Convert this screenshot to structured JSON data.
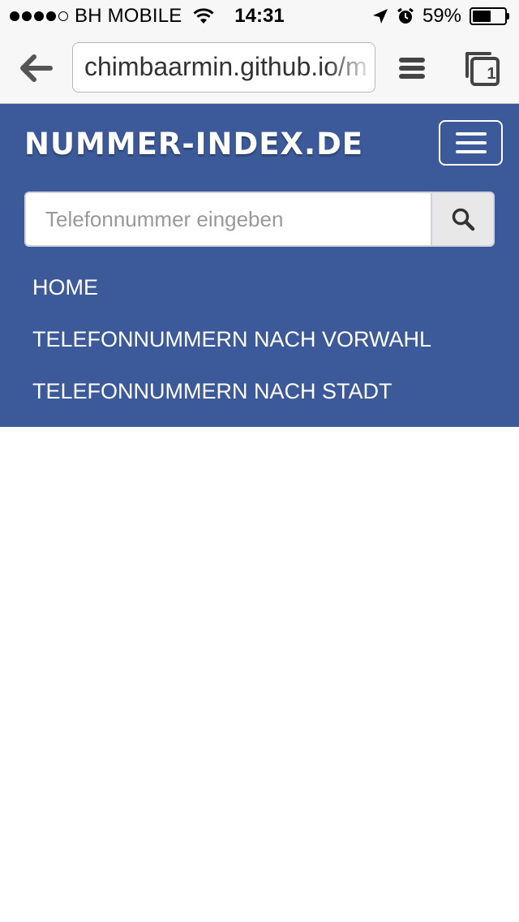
{
  "status_bar": {
    "carrier": "BH MOBILE",
    "time": "14:31",
    "battery_percent": "59%",
    "battery_level": 0.59,
    "signal_bars": 4,
    "signal_max": 5
  },
  "browser": {
    "url": "chimbaarmin.github.io/m",
    "tab_count": "1"
  },
  "site": {
    "brand": "NUMMER-INDEX.DE",
    "search_placeholder": "Telefonnummer eingeben",
    "nav": [
      {
        "label": "HOME"
      },
      {
        "label": "TELEFONNUMMERN NACH VORWAHL"
      },
      {
        "label": "TELEFONNUMMERN NACH STADT"
      }
    ]
  },
  "colors": {
    "navbar_bg": "#3c5a99",
    "toolbar_bg": "#f7f7f7"
  },
  "icons": {
    "back": "arrow-left-icon",
    "menu": "hamburger-icon",
    "tabs": "tabs-icon",
    "search": "search-icon",
    "wifi": "wifi-icon",
    "location": "location-arrow-icon",
    "alarm": "alarm-icon",
    "battery": "battery-icon"
  }
}
